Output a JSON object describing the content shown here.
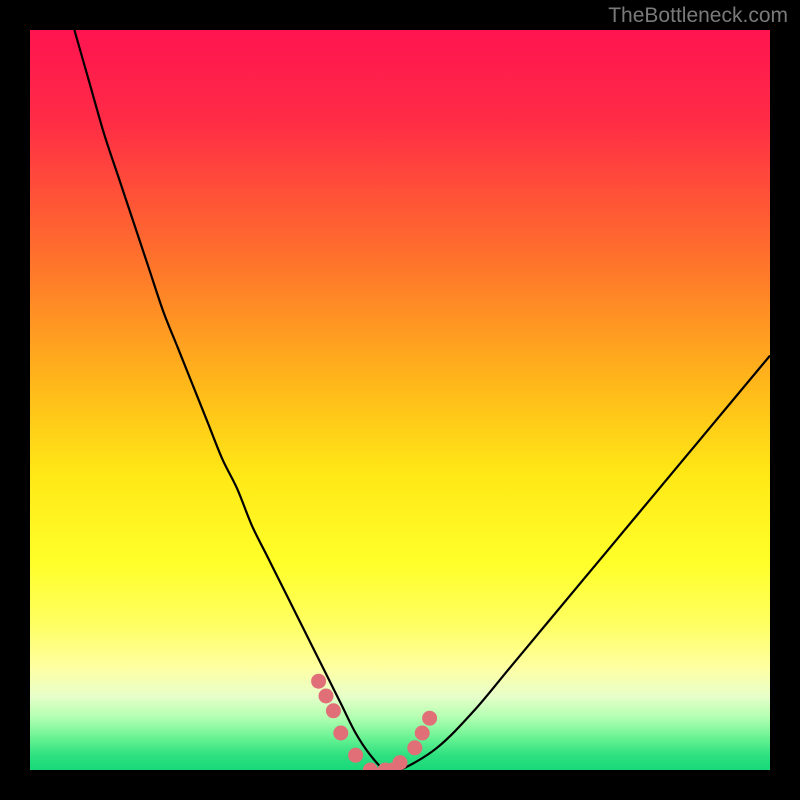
{
  "watermark": "TheBottleneck.com",
  "chart_data": {
    "type": "line",
    "title": "",
    "xlabel": "",
    "ylabel": "",
    "xlim": [
      0,
      100
    ],
    "ylim": [
      0,
      100
    ],
    "grid": false,
    "series": [
      {
        "name": "bottleneck-curve",
        "x": [
          6,
          8,
          10,
          12,
          14,
          16,
          18,
          20,
          22,
          24,
          26,
          28,
          30,
          32,
          34,
          36,
          38,
          40,
          42,
          44,
          46,
          48,
          50,
          55,
          60,
          65,
          70,
          75,
          80,
          85,
          90,
          95,
          100
        ],
        "y": [
          100,
          93,
          86,
          80,
          74,
          68,
          62,
          57,
          52,
          47,
          42,
          38,
          33,
          29,
          25,
          21,
          17,
          13,
          9,
          5,
          2,
          0,
          0,
          3,
          8,
          14,
          20,
          26,
          32,
          38,
          44,
          50,
          56
        ]
      }
    ],
    "highlight_points": {
      "name": "pink-dots",
      "color": "#e06f78",
      "x": [
        39,
        40,
        41,
        42,
        44,
        46,
        48,
        49,
        50,
        52,
        53,
        54
      ],
      "y": [
        12,
        10,
        8,
        5,
        2,
        0,
        0,
        0,
        1,
        3,
        5,
        7
      ]
    },
    "gradient_stops": [
      {
        "offset": 0,
        "color": "#ff1450"
      },
      {
        "offset": 12,
        "color": "#ff2b46"
      },
      {
        "offset": 30,
        "color": "#ff6e2d"
      },
      {
        "offset": 48,
        "color": "#ffb81a"
      },
      {
        "offset": 60,
        "color": "#ffe816"
      },
      {
        "offset": 72,
        "color": "#ffff2a"
      },
      {
        "offset": 80,
        "color": "#ffff60"
      },
      {
        "offset": 86,
        "color": "#ffffa0"
      },
      {
        "offset": 90,
        "color": "#e8ffca"
      },
      {
        "offset": 93,
        "color": "#b0ffb0"
      },
      {
        "offset": 96,
        "color": "#60f090"
      },
      {
        "offset": 98,
        "color": "#2ee080"
      },
      {
        "offset": 100,
        "color": "#18d878"
      }
    ]
  }
}
